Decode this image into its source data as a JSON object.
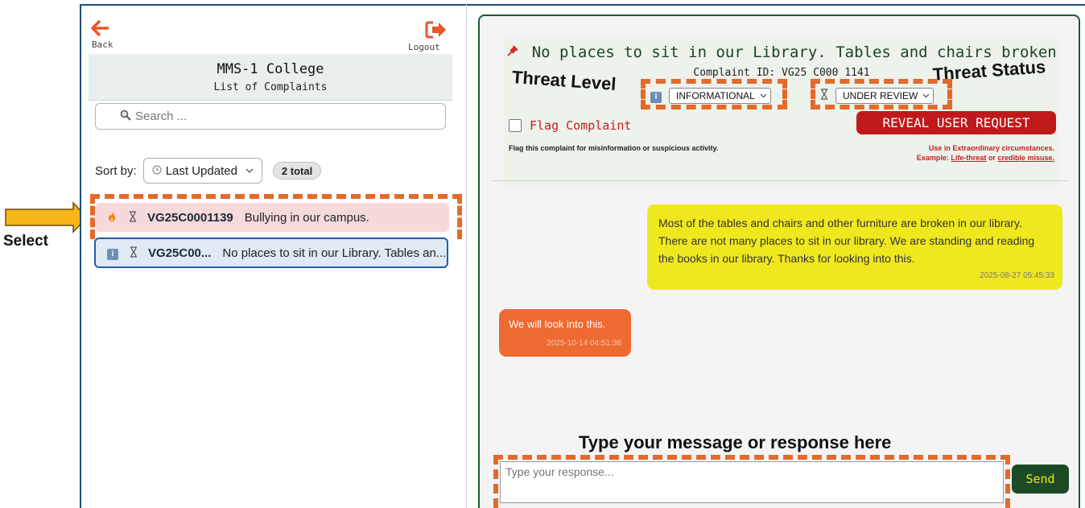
{
  "nav": {
    "back_label": "Back",
    "logout_label": "Logout"
  },
  "college": {
    "name": "MMS-1 College",
    "subtitle": "List of Complaints"
  },
  "search": {
    "placeholder": "Search ..."
  },
  "sort": {
    "label": "Sort by:",
    "selected": "Last Updated",
    "total": "2 total"
  },
  "complaints": [
    {
      "id": "VG25C0001139",
      "title": "Bullying in our campus.",
      "level_icon": "fire-icon",
      "status_icon": "hourglass-icon"
    },
    {
      "id": "VG25C00...",
      "title": "No places to sit in our Library. Tables an...",
      "level_icon": "info-icon",
      "status_icon": "hourglass-icon"
    }
  ],
  "annotations": {
    "select": "Select",
    "threat_level": "Threat Level",
    "threat_status": "Threat Status",
    "type_message": "Type your message or response here"
  },
  "detail": {
    "title": "No places to sit in our Library. Tables and chairs broken",
    "complaint_id": "Complaint ID: VG25 C000 1141",
    "threat_level": "INFORMATIONAL",
    "threat_status": "UNDER REVIEW",
    "flag_label": "Flag Complaint",
    "flag_desc": "Flag this complaint for misinformation or suspicious activity.",
    "reveal_label": "REVEAL USER REQUEST",
    "reveal_note1": "Use in Extraordinary circumstances.",
    "reveal_note2_prefix": "Example: ",
    "reveal_note2_link1": "Life-threat",
    "reveal_note2_mid": " or ",
    "reveal_note2_link2": "credible misuse."
  },
  "messages": [
    {
      "text": "Most of the tables and chairs and other furniture are broken in our library. There are not many places to sit in our library. We are standing and reading the books in our library. Thanks for looking into this.",
      "time": "2025-08-27 05:45:33"
    },
    {
      "text": "We will look into this.",
      "time": "2025-10-14 04:51:38"
    }
  ],
  "response": {
    "placeholder": "Type your response...",
    "send_label": "Send"
  },
  "colors": {
    "accent_orange": "#e46a2a",
    "brand_green": "#1c4a24",
    "reveal_red": "#c0191b",
    "user_bubble": "#f0e81e",
    "admin_bubble": "#ee6a30"
  }
}
